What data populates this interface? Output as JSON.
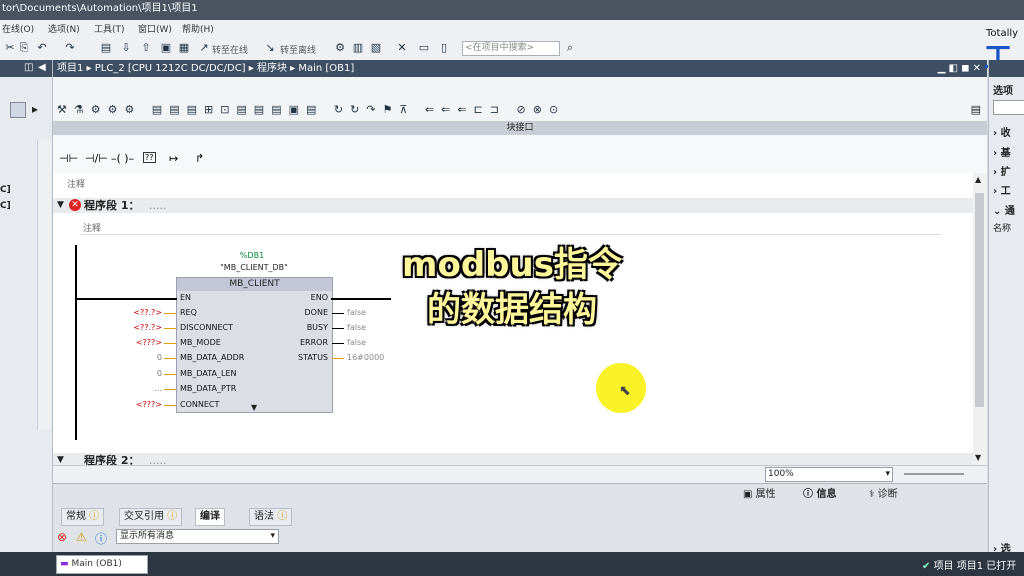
{
  "window": {
    "title": "tor\\Documents\\Automation\\项目1\\项目1"
  },
  "menu": [
    "在线(O)",
    "选项(N)",
    "工具(T)",
    "窗口(W)",
    "帮助(H)"
  ],
  "toolbar": {
    "go_online": "转至在线",
    "go_offline": "转至离线",
    "search_placeholder": "<在项目中搜索>"
  },
  "left_pane": {
    "items": [
      "C]",
      "C]"
    ]
  },
  "editor": {
    "breadcrumb": "项目1 ▸ PLC_2 [CPU 1212C DC/DC/DC] ▸ 程序块 ▸ Main [OB1]",
    "block_interface": "块接口",
    "comment_label": "注释",
    "segment1_title": "程序段 1：",
    "segment1_dots": ".....",
    "segment1_comment": "注释",
    "segment2_title": "程序段 2：",
    "segment2_dots": ".....",
    "zoom": "100%"
  },
  "ladder_tools": [
    "⊣⊢",
    "⊣/⊢",
    "–( )–",
    "??",
    "↦",
    "↱"
  ],
  "fb": {
    "instance_addr": "%DB1",
    "instance_name": "\"MB_CLIENT_DB\"",
    "name": "MB_CLIENT",
    "inputs": [
      {
        "pin": "EN",
        "value": ""
      },
      {
        "pin": "REQ",
        "value": "<??.?>"
      },
      {
        "pin": "DISCONNECT",
        "value": "<??.?>"
      },
      {
        "pin": "MB_MODE",
        "value": "<???>"
      },
      {
        "pin": "MB_DATA_ADDR",
        "value": "0"
      },
      {
        "pin": "MB_DATA_LEN",
        "value": "0"
      },
      {
        "pin": "MB_DATA_PTR",
        "value": "..."
      },
      {
        "pin": "CONNECT",
        "value": "<???>"
      }
    ],
    "outputs": [
      {
        "pin": "ENO",
        "value": ""
      },
      {
        "pin": "DONE",
        "value": "false"
      },
      {
        "pin": "BUSY",
        "value": "false"
      },
      {
        "pin": "ERROR",
        "value": "false"
      },
      {
        "pin": "STATUS",
        "value": "16#0000"
      }
    ]
  },
  "overlay": {
    "line1": "modbus指令",
    "line2": "的数据结构"
  },
  "inspector": {
    "prop_tabs": [
      "属性",
      "信息",
      "诊断"
    ],
    "tabs": [
      "常规",
      "交叉引用",
      "编译",
      "语法"
    ],
    "filter": "显示所有消息"
  },
  "right_pane": {
    "brand": "Totally",
    "brand_big": "工",
    "options_title": "选项",
    "sections": [
      "收",
      "基",
      "扩",
      "工",
      "通"
    ],
    "name_header": "名称",
    "bottom_item": "选"
  },
  "statusbar": {
    "task": "Main (OB1)",
    "project_status": "项目 项目1 已打开"
  }
}
